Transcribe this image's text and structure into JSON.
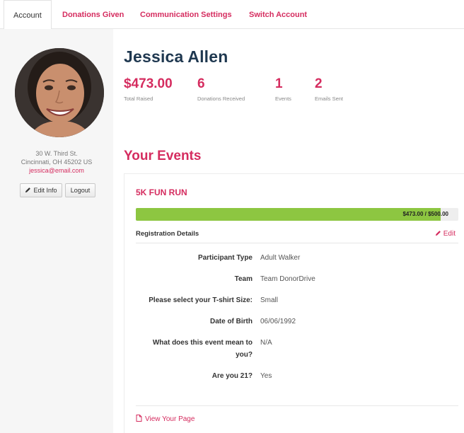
{
  "tabs": [
    {
      "label": "Account"
    },
    {
      "label": "Donations Given"
    },
    {
      "label": "Communication Settings"
    },
    {
      "label": "Switch Account"
    }
  ],
  "profile": {
    "name": "Jessica Allen",
    "address_line1": "30 W. Third St.",
    "address_line2": "Cincinnati, OH 45202 US",
    "email": "jessica@email.com",
    "edit_label": "Edit Info",
    "logout_label": "Logout",
    "avatar_icon": "user-photo"
  },
  "stats": [
    {
      "value": "$473.00",
      "label": "Total Raised"
    },
    {
      "value": "6",
      "label": "Donations Received"
    },
    {
      "value": "1",
      "label": "Events"
    },
    {
      "value": "2",
      "label": "Emails Sent"
    }
  ],
  "events_section_title": "Your Events",
  "event": {
    "title": "5K FUN RUN",
    "progress_text": "$473.00 / $500.00",
    "progress_fraction": 0.946,
    "registration_title": "Registration Details",
    "edit_label": "Edit",
    "fields": [
      {
        "label": "Participant Type",
        "value": "Adult Walker"
      },
      {
        "label": "Team",
        "value": "Team DonorDrive"
      },
      {
        "label": "Please select your T-shirt Size:",
        "value": "Small"
      },
      {
        "label": "Date of Birth",
        "value": "06/06/1992"
      },
      {
        "label_line1": "What does this event mean to",
        "label_line2": "you?",
        "value": "N/A"
      },
      {
        "label": "Are you 21?",
        "value": "Yes"
      }
    ],
    "view_page_label": "View Your Page"
  },
  "colors": {
    "accent": "#d52c5f",
    "name": "#1f3850",
    "progress": "#8dc641"
  }
}
